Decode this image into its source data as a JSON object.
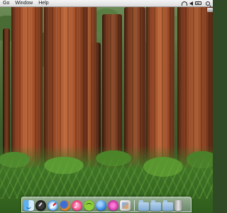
{
  "menubar": {
    "items": [
      "Go",
      "Window",
      "Help"
    ],
    "clock": "",
    "tray_icons": [
      "spotlight-icon",
      "volume-icon",
      "wifi-icon",
      "battery-icon"
    ]
  },
  "wallpaper": {
    "subject": "",
    "colors": {
      "bark": "#9b4a26",
      "foliage": "#496b34",
      "ferns": "#4f8a2e"
    }
  },
  "dock": {
    "apps": [
      "finder-icon",
      "dashboard-icon",
      "safari-icon",
      "firefox-icon",
      "itunes-icon",
      "spotify-icon",
      "ichat-icon",
      "mail-icon",
      "photos-icon"
    ],
    "stacks": [
      "folder-icon",
      "folder-icon",
      "folder-icon",
      "trash-icon"
    ]
  }
}
